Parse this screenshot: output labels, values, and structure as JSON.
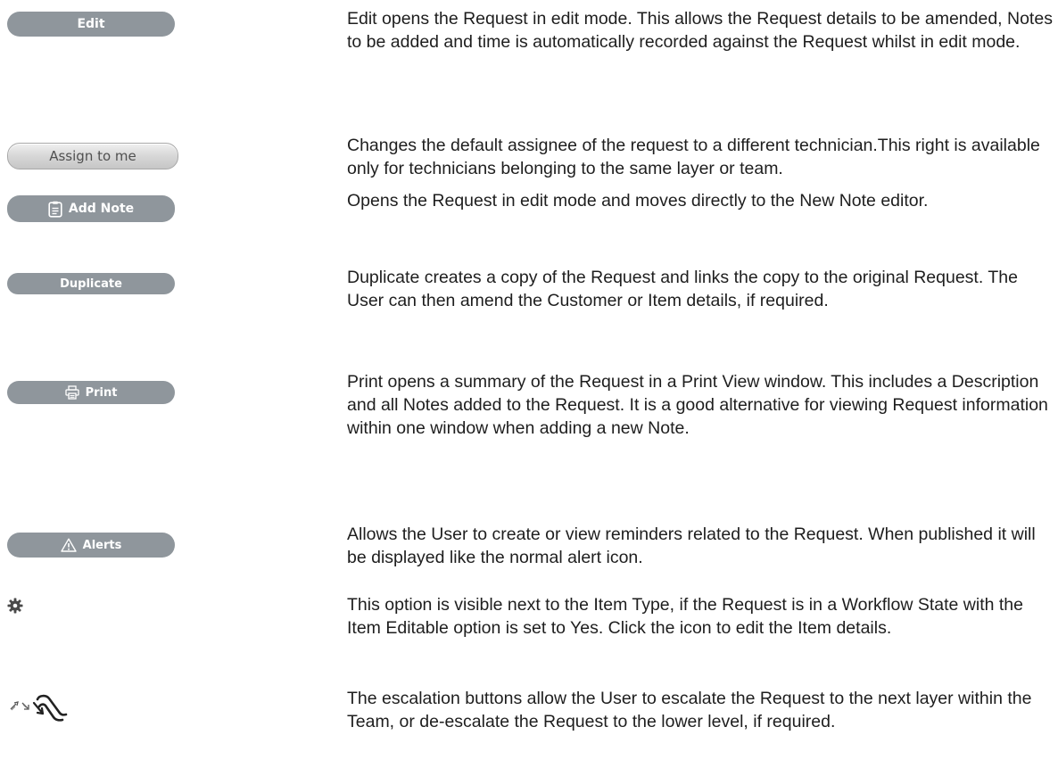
{
  "rows": [
    {
      "button_label": "Edit",
      "description": "Edit opens the Request in edit mode. This allows the Request details to be amended, Notes to be added and time is automatically recorded against the Request whilst in edit mode."
    },
    {
      "button_label": "Assign to me",
      "description": "Changes the default assignee of the request to a different technician.This right is available only for technicians belonging to the same layer or team."
    },
    {
      "button_label": "Add Note",
      "icon": "note-icon",
      "description": "Opens the Request in edit mode and moves directly to the New Note editor."
    },
    {
      "button_label": "Duplicate",
      "description": "Duplicate creates a copy of the Request and links the copy to the original Request. The User can then amend the Customer or Item details, if required."
    },
    {
      "button_label": "Print",
      "icon": "printer-icon",
      "description": "Print opens a summary of the Request in a Print View window. This includes a Description and all Notes added to the Request. It is a good alternative for viewing Request information within one window when adding a new Note."
    },
    {
      "button_label": "Alerts",
      "icon": "warning-triangle-icon",
      "description": "Allows the User to create or view reminders related to the Request. When published it will be displayed like the normal alert icon."
    },
    {
      "icon": "gear-icon",
      "description": "This option is visible next to the Item Type, if the Request is in a Workflow State with the Item Editable option is set to Yes. Click the icon to edit the Item details."
    },
    {
      "icon": "escalation-icon",
      "description": "The escalation buttons allow the User to escalate the Request to the next layer within the Team, or de-escalate the Request to the lower level, if required."
    }
  ]
}
